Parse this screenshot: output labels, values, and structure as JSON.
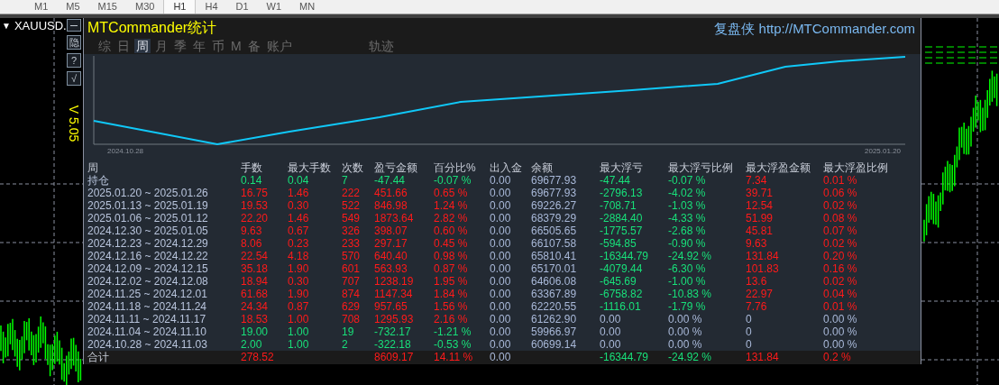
{
  "toolbar": {
    "timeframes": [
      {
        "label": "M1",
        "selected": false
      },
      {
        "label": "M5",
        "selected": false
      },
      {
        "label": "M15",
        "selected": false
      },
      {
        "label": "M30",
        "selected": false
      },
      {
        "label": "H1",
        "selected": true
      },
      {
        "label": "H4",
        "selected": false
      },
      {
        "label": "D1",
        "selected": false
      },
      {
        "label": "W1",
        "selected": false
      },
      {
        "label": "MN",
        "selected": false
      }
    ]
  },
  "chart_window": {
    "collapse_glyph": "▼",
    "symbol": "XAUUSD.",
    "side_buttons": [
      "隐",
      "?",
      "√"
    ],
    "version": "V 5.05"
  },
  "panel": {
    "title": "MTCommander统计",
    "site": "复盘侠 http://MTCommander.com",
    "tabs": [
      {
        "label": "综",
        "selected": false
      },
      {
        "label": "日",
        "selected": false
      },
      {
        "label": "周",
        "selected": true
      },
      {
        "label": "月",
        "selected": false
      },
      {
        "label": "季",
        "selected": false
      },
      {
        "label": "年",
        "selected": false
      },
      {
        "label": "币",
        "selected": false
      },
      {
        "label": "M",
        "selected": false
      },
      {
        "label": "备",
        "selected": false
      },
      {
        "label": "账户",
        "selected": false
      }
    ],
    "trend": {
      "label": "轨迹",
      "start_label": "2024.10.28",
      "end_label": "2025.01.20"
    },
    "table": {
      "columns": [
        "周",
        "手数",
        "最大手数",
        "次数",
        "盈亏金额",
        "百分比%",
        "出入金",
        "余额",
        "最大浮亏",
        "最大浮亏比例",
        "最大浮盈金额",
        "最大浮盈比例"
      ],
      "rows": [
        {
          "period": "持仓",
          "profit": false,
          "floating": true,
          "values": [
            "0.14",
            "0.04",
            "7",
            "-47.44",
            "-0.07 %",
            "0.00",
            "69677.93",
            "-47.44",
            "-0.07 %",
            "7.34",
            "0.01 %"
          ]
        },
        {
          "period": "2025.01.20 ~ 2025.01.26",
          "profit": true,
          "floating": true,
          "values": [
            "16.75",
            "1.46",
            "222",
            "451.66",
            "0.65 %",
            "0.00",
            "69677.93",
            "-2796.13",
            "-4.02 %",
            "39.71",
            "0.06 %"
          ]
        },
        {
          "period": "2025.01.13 ~ 2025.01.19",
          "profit": true,
          "floating": true,
          "values": [
            "19.53",
            "0.30",
            "522",
            "846.98",
            "1.24 %",
            "0.00",
            "69226.27",
            "-708.71",
            "-1.03 %",
            "12.54",
            "0.02 %"
          ]
        },
        {
          "period": "2025.01.06 ~ 2025.01.12",
          "profit": true,
          "floating": true,
          "values": [
            "22.20",
            "1.46",
            "549",
            "1873.64",
            "2.82 %",
            "0.00",
            "68379.29",
            "-2884.40",
            "-4.33 %",
            "51.99",
            "0.08 %"
          ]
        },
        {
          "period": "2024.12.30 ~ 2025.01.05",
          "profit": true,
          "floating": true,
          "values": [
            "9.63",
            "0.67",
            "326",
            "398.07",
            "0.60 %",
            "0.00",
            "66505.65",
            "-1775.57",
            "-2.68 %",
            "45.81",
            "0.07 %"
          ]
        },
        {
          "period": "2024.12.23 ~ 2024.12.29",
          "profit": true,
          "floating": true,
          "values": [
            "8.06",
            "0.23",
            "233",
            "297.17",
            "0.45 %",
            "0.00",
            "66107.58",
            "-594.85",
            "-0.90 %",
            "9.63",
            "0.02 %"
          ]
        },
        {
          "period": "2024.12.16 ~ 2024.12.22",
          "profit": true,
          "floating": true,
          "values": [
            "22.54",
            "4.18",
            "570",
            "640.40",
            "0.98 %",
            "0.00",
            "65810.41",
            "-16344.79",
            "-24.92 %",
            "131.84",
            "0.20 %"
          ]
        },
        {
          "period": "2024.12.09 ~ 2024.12.15",
          "profit": true,
          "floating": true,
          "values": [
            "35.18",
            "1.90",
            "601",
            "563.93",
            "0.87 %",
            "0.00",
            "65170.01",
            "-4079.44",
            "-6.30 %",
            "101.83",
            "0.16 %"
          ]
        },
        {
          "period": "2024.12.02 ~ 2024.12.08",
          "profit": true,
          "floating": true,
          "values": [
            "18.94",
            "0.30",
            "707",
            "1238.19",
            "1.95 %",
            "0.00",
            "64606.08",
            "-645.69",
            "-1.00 %",
            "13.6",
            "0.02 %"
          ]
        },
        {
          "period": "2024.11.25 ~ 2024.12.01",
          "profit": true,
          "floating": true,
          "values": [
            "61.68",
            "1.90",
            "874",
            "1147.34",
            "1.84 %",
            "0.00",
            "63367.89",
            "-6758.82",
            "-10.83 %",
            "22.97",
            "0.04 %"
          ]
        },
        {
          "period": "2024.11.18 ~ 2024.11.24",
          "profit": true,
          "floating": true,
          "values": [
            "24.34",
            "0.87",
            "629",
            "957.65",
            "1.56 %",
            "0.00",
            "62220.55",
            "-1116.01",
            "-1.79 %",
            "7.76",
            "0.01 %"
          ]
        },
        {
          "period": "2024.11.11 ~ 2024.11.17",
          "profit": true,
          "floating": false,
          "values": [
            "18.53",
            "1.00",
            "708",
            "1295.93",
            "2.16 %",
            "0.00",
            "61262.90",
            "0.00",
            "0.00 %",
            "0",
            "0.00 %"
          ]
        },
        {
          "period": "2024.11.04 ~ 2024.11.10",
          "profit": false,
          "floating": false,
          "values": [
            "19.00",
            "1.00",
            "19",
            "-732.17",
            "-1.21 %",
            "0.00",
            "59966.97",
            "0.00",
            "0.00 %",
            "0",
            "0.00 %"
          ]
        },
        {
          "period": "2024.10.28 ~ 2024.11.03",
          "profit": false,
          "floating": false,
          "values": [
            "2.00",
            "1.00",
            "2",
            "-322.18",
            "-0.53 %",
            "0.00",
            "60699.14",
            "0.00",
            "0.00 %",
            "0",
            "0.00 %"
          ]
        }
      ],
      "total": {
        "label": "合计",
        "profit": true,
        "lots": "278.52",
        "pnl": "8609.17",
        "pct": "14.11 %",
        "io": "0.00",
        "drawdown": "-16344.79",
        "drawdown_pct": "-24.92 %",
        "float_profit": "131.84",
        "float_profit_pct": "0.2 %"
      }
    }
  }
}
